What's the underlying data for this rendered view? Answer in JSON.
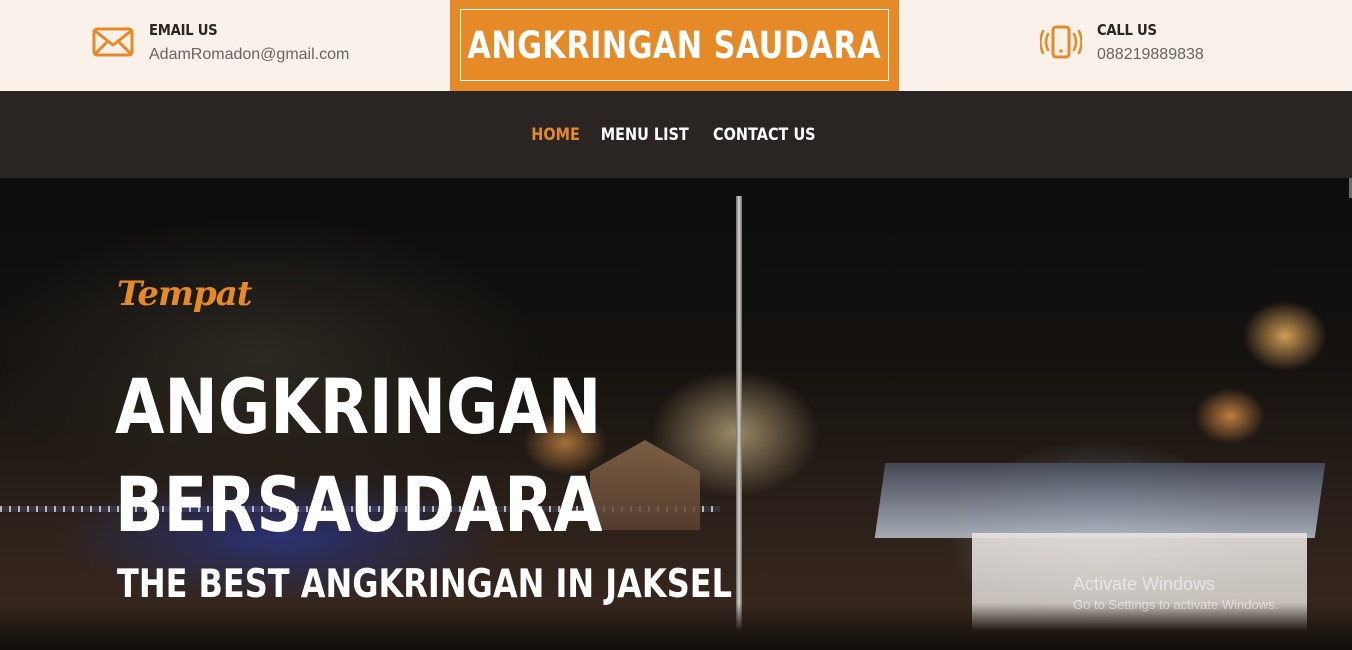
{
  "header": {
    "email": {
      "label": "EMAIL US",
      "value": "AdamRomadon@gmail.com",
      "icon": "envelope-icon"
    },
    "brand": {
      "title": "ANGKRINGAN SAUDARA"
    },
    "call": {
      "label": "CALL US",
      "value": "088219889838",
      "icon": "phone-vibrate-icon"
    }
  },
  "nav": {
    "items": [
      {
        "label": "HOME",
        "active": true
      },
      {
        "label": "MENU LIST",
        "active": false
      },
      {
        "label": "CONTACT US",
        "active": false
      }
    ]
  },
  "hero": {
    "kicker": "Tempat",
    "headline_line1": "ANGKRINGAN",
    "headline_line2": "BERSAUDARA",
    "tagline": "THE BEST ANGKRINGAN IN JAKSEL"
  },
  "watermark": {
    "line1": "Activate Windows",
    "line2": "Go to Settings to activate Windows."
  },
  "colors": {
    "accent": "#e68a28",
    "navbar": "#2a2522",
    "topbar": "#faf1ea"
  }
}
